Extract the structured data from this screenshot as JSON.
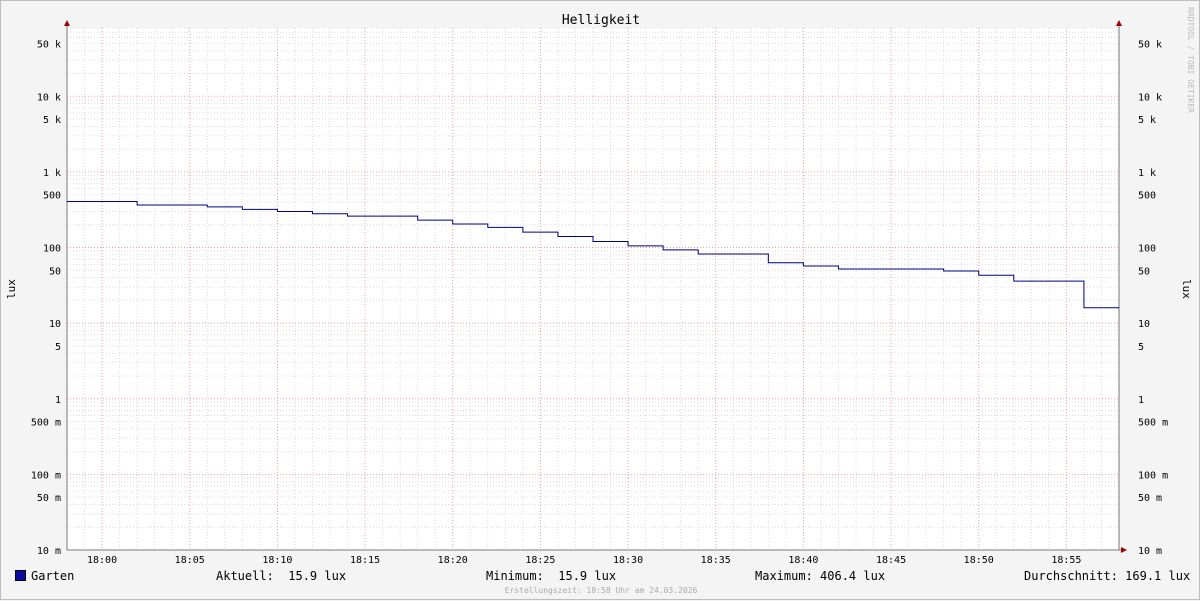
{
  "chart_data": {
    "type": "line",
    "title": "Helligkeit",
    "ylabel": "lux",
    "yscale": "log",
    "ylim": [
      0.01,
      80000
    ],
    "xlim": [
      "17:58",
      "18:58"
    ],
    "x_ticks": [
      "18:00",
      "18:05",
      "18:10",
      "18:15",
      "18:20",
      "18:25",
      "18:30",
      "18:35",
      "18:40",
      "18:45",
      "18:50",
      "18:55"
    ],
    "y_ticks": [
      {
        "value": 50000,
        "label": "50 k"
      },
      {
        "value": 10000,
        "label": "10 k"
      },
      {
        "value": 5000,
        "label": "5 k"
      },
      {
        "value": 1000,
        "label": "1 k"
      },
      {
        "value": 500,
        "label": "500"
      },
      {
        "value": 100,
        "label": "100"
      },
      {
        "value": 50,
        "label": "50"
      },
      {
        "value": 10,
        "label": "10"
      },
      {
        "value": 5,
        "label": "5"
      },
      {
        "value": 1,
        "label": "1"
      },
      {
        "value": 0.5,
        "label": "500 m"
      },
      {
        "value": 0.1,
        "label": "100 m"
      },
      {
        "value": 0.05,
        "label": "50 m"
      },
      {
        "value": 0.01,
        "label": "10 m"
      }
    ],
    "grid": true,
    "series": [
      {
        "name": "Garten",
        "color": "#000080",
        "x": [
          "17:58",
          "18:02",
          "18:06",
          "18:08",
          "18:10",
          "18:12",
          "18:14",
          "18:18",
          "18:20",
          "18:22",
          "18:24",
          "18:26",
          "18:28",
          "18:30",
          "18:32",
          "18:34",
          "18:38",
          "18:40",
          "18:42",
          "18:48",
          "18:50",
          "18:52",
          "18:56",
          "18:58"
        ],
        "y": [
          406.4,
          365,
          345,
          320,
          300,
          280,
          260,
          230,
          205,
          185,
          160,
          140,
          120,
          105,
          93,
          82,
          63,
          57,
          52,
          49,
          43,
          36,
          16,
          15.9
        ]
      }
    ]
  },
  "legend": {
    "series_name": "Garten",
    "current": "Aktuell:  15.9 lux",
    "minimum": "Minimum:  15.9 lux",
    "maximum": "Maximum: 406.4 lux",
    "average": "Durchschnitt: 169.1 lux"
  },
  "watermark": "RRDTOOL / TOBI OETIKER",
  "created": "Erstellungszeit: 18:58 Uhr am 24.03.2026"
}
